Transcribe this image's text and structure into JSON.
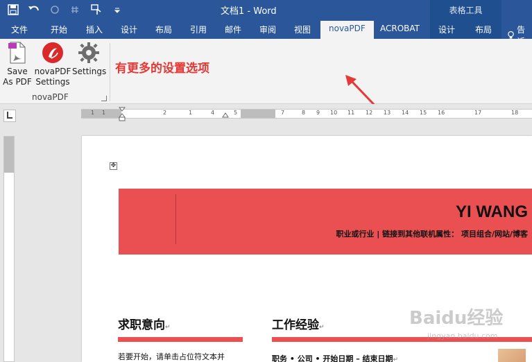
{
  "titlebar": {
    "doc_title": "文档1 - Word",
    "context_group": "表格工具",
    "icons": [
      "save-icon",
      "undo-icon",
      "redo-icon",
      "repeat-icon",
      "touch-mode-icon",
      "customize-qat-icon"
    ]
  },
  "tabs": {
    "items": [
      "文件",
      "开始",
      "插入",
      "设计",
      "布局",
      "引用",
      "邮件",
      "审阅",
      "视图",
      "novaPDF",
      "ACROBAT",
      "设计",
      "布局"
    ],
    "active": "novaPDF",
    "tell_me": "告诉"
  },
  "ribbon": {
    "save_as_pdf": [
      "Save",
      "As PDF"
    ],
    "novapdf_settings": [
      "novaPDF",
      "Settings"
    ],
    "settings": "Settings",
    "group_label": "novaPDF",
    "annotation": "有更多的设置选项"
  },
  "ruler": {
    "numbers": [
      "1",
      "1",
      "2",
      "1",
      "4",
      "5",
      "7",
      "8",
      "9",
      "10",
      "11",
      "12",
      "13",
      "14",
      "15",
      "16",
      "17",
      "18"
    ]
  },
  "document": {
    "name": "YI WANG",
    "subline": "职业或行业 | 链接到其他联机属性： 项目组合/网站/博客",
    "section_objective": "求职意向",
    "section_experience": "工作经验",
    "objective_text": "若要开始，请单击占位符文本并",
    "experience_text": "职务 • 公司 • 开始日期 – 结束日期"
  },
  "watermark": {
    "text": "Baidu经验",
    "sub": "jingyan.baidu.com"
  },
  "colors": {
    "word_blue": "#2b579a",
    "banner_red": "#ea5052",
    "annotation_red": "#e53935"
  }
}
